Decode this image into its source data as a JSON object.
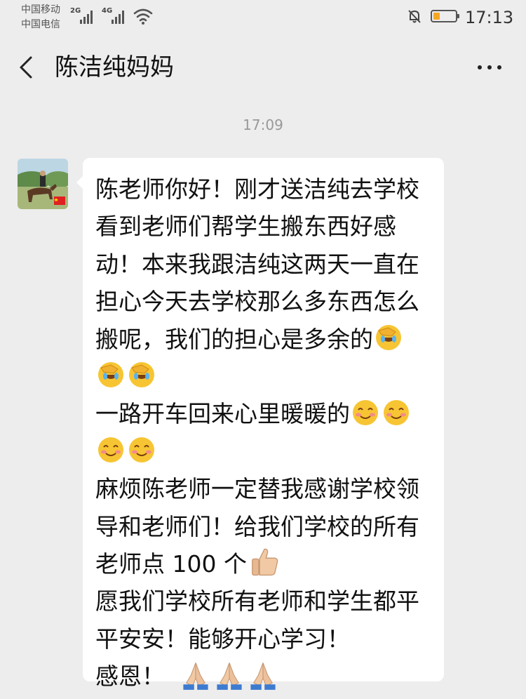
{
  "status_bar": {
    "carrier_1": "中国移动",
    "carrier_2": "中国电信",
    "network_1": "2G",
    "network_2": "4G",
    "time": "17:13",
    "battery_color": "#f5a623"
  },
  "header": {
    "back_icon": "chevron-left-icon",
    "title": "陈洁纯妈妈",
    "more_icon": "ellipsis-icon"
  },
  "chat": {
    "timestamp": "17:09",
    "message": {
      "avatar": "horse-rider-photo",
      "lines": {
        "l1": "陈老师你好！刚才送洁纯去学校",
        "l2": "看到老师们帮学生搬东西好感",
        "l3": "动！本来我跟洁纯这两天一直在",
        "l4": "担心今天去学校那么多东西怎么",
        "l5": "搬呢，我们的担心是多余的",
        "l7": "一路开车回来心里暖暖的",
        "l9": "麻烦陈老师一定替我感谢学校领",
        "l10": "导和老师们！给我们学校的所有",
        "l11": "老师点 100 个",
        "l12": "愿我们学校所有老师和学生都平",
        "l13": "平安安！能够开心学习！",
        "l14": "感恩！"
      },
      "emoji": {
        "facepalm": "facepalm-laughing-emoji",
        "blush": "blushing-smile-emoji",
        "thumbs_up": "thumbs-up-emoji",
        "pray": "praying-hands-emoji"
      }
    }
  }
}
